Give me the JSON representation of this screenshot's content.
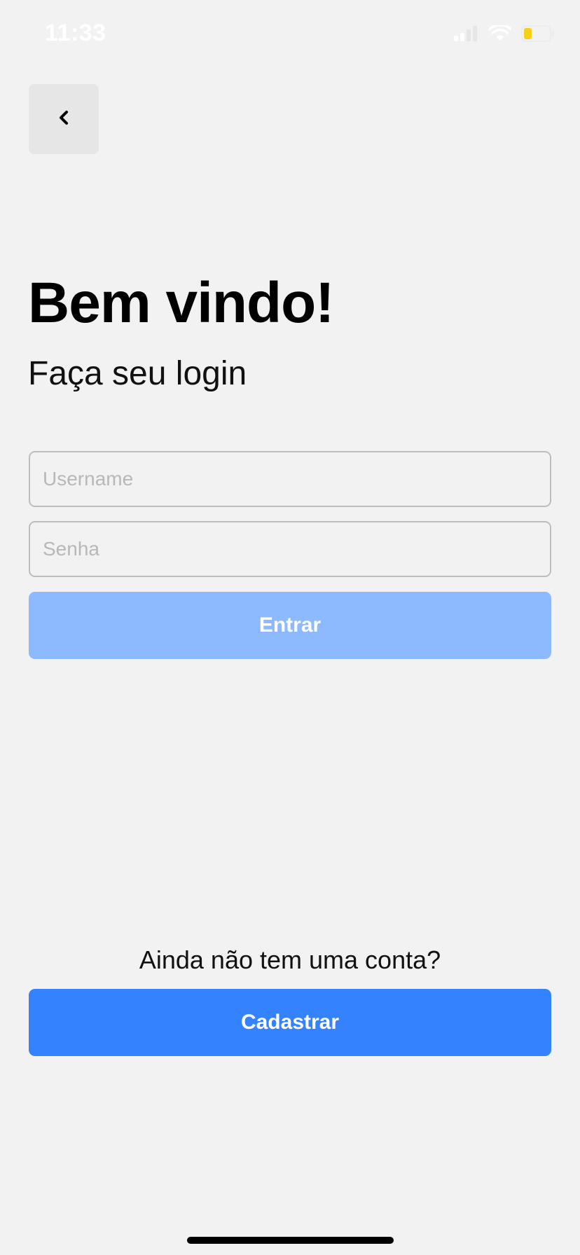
{
  "status_bar": {
    "time": "11:33",
    "icons": [
      "signal-icon",
      "wifi-icon",
      "battery-icon"
    ]
  },
  "nav": {
    "back_icon": "chevron-left-icon"
  },
  "header": {
    "title": "Bem vindo!",
    "subtitle": "Faça seu login"
  },
  "form": {
    "username_placeholder": "Username",
    "username_value": "",
    "password_placeholder": "Senha",
    "password_value": "",
    "login_label": "Entrar"
  },
  "footer": {
    "prompt": "Ainda não tem uma conta?",
    "register_label": "Cadastrar"
  },
  "colors": {
    "background": "#f2f2f2",
    "primary": "#3482fd",
    "primary_disabled": "#8dbafe",
    "battery_level": "#f7d117"
  }
}
